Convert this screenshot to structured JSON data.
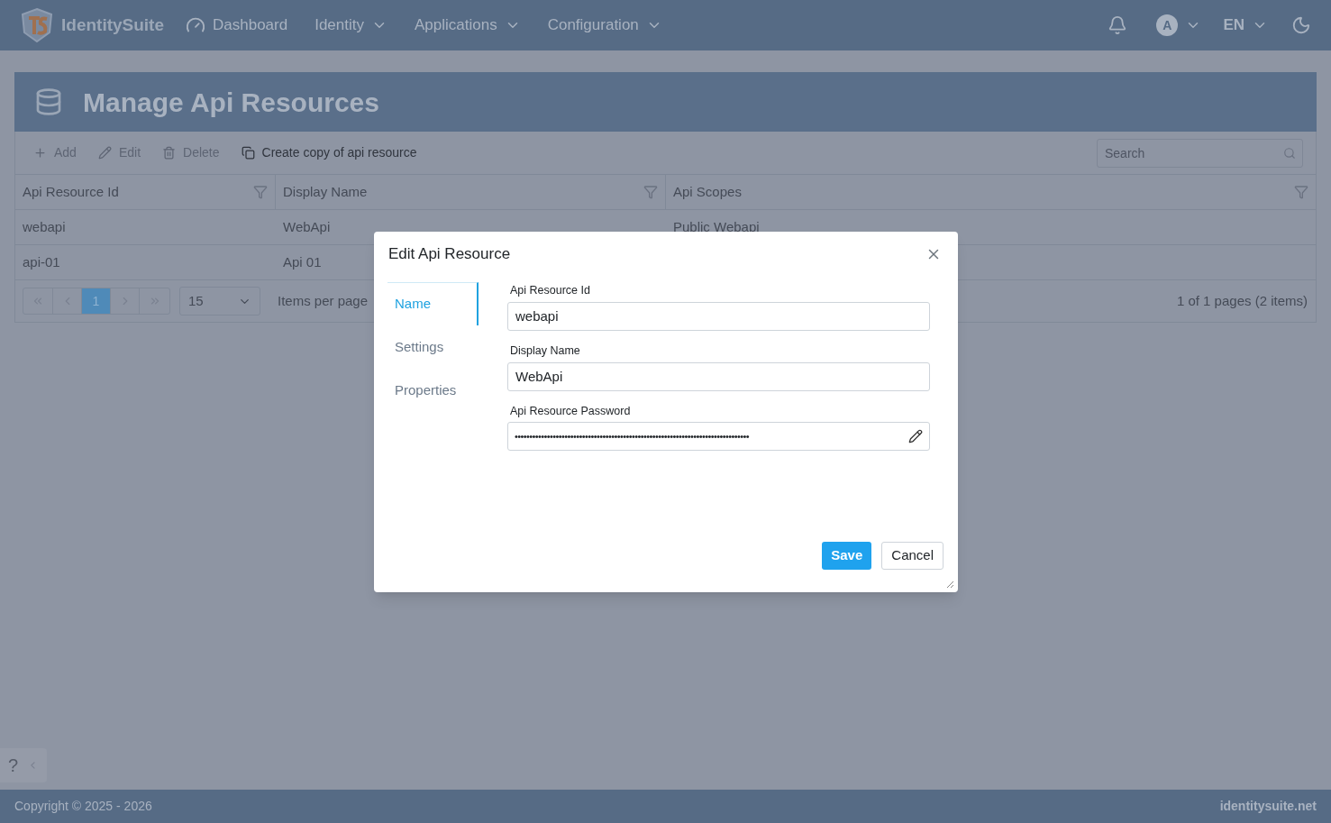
{
  "nav": {
    "brand": "IdentitySuite",
    "items": [
      {
        "label": "Dashboard",
        "kind": "link"
      },
      {
        "label": "Identity",
        "kind": "menu"
      },
      {
        "label": "Applications",
        "kind": "menu"
      },
      {
        "label": "Configuration",
        "kind": "menu"
      }
    ],
    "avatar": "A",
    "language": "EN"
  },
  "page_title": "Manage Api Resources",
  "toolbar": [
    {
      "label": "Add",
      "kind": "add",
      "disabled": true
    },
    {
      "label": "Edit",
      "kind": "edit",
      "disabled": true
    },
    {
      "label": "Delete",
      "kind": "delete",
      "disabled": true
    },
    {
      "label": "Create copy of api resource",
      "kind": "copy",
      "disabled": false
    }
  ],
  "search": {
    "placeholder": "Search"
  },
  "table": {
    "columns": [
      "Api Resource Id",
      "Display Name",
      "Api Scopes"
    ],
    "rows": [
      [
        "webapi",
        "WebApi",
        "Public Webapi"
      ],
      [
        "api-01",
        "Api 01",
        ""
      ]
    ]
  },
  "pager": {
    "pages": [
      {
        "label": "1",
        "selected": true
      }
    ],
    "page_size": "15",
    "page_size_label": "Items per page",
    "summary": "1 of 1 pages (2 items)"
  },
  "dialog": {
    "title": "Edit Api Resource",
    "tabs": [
      {
        "label": "Name",
        "selected": true
      },
      {
        "label": "Settings",
        "selected": false
      },
      {
        "label": "Properties",
        "selected": false
      }
    ],
    "fields": [
      {
        "label": "Api Resource Id",
        "value": "webapi",
        "kind": "text"
      },
      {
        "label": "Display Name",
        "value": "WebApi",
        "kind": "text"
      },
      {
        "label": "Api Resource Password",
        "value": "••••••••••••••••••••••••••••••••••••••••••••••••••••••••••••••••••••••••••••••••",
        "kind": "password"
      }
    ],
    "buttons": [
      {
        "label": "Save",
        "kind": "primary"
      },
      {
        "label": "Cancel",
        "kind": "secondary"
      }
    ]
  },
  "help": "?",
  "footer": {
    "copyright": "Copyright © 2025 - 2026",
    "site": "identitysuite.net"
  }
}
